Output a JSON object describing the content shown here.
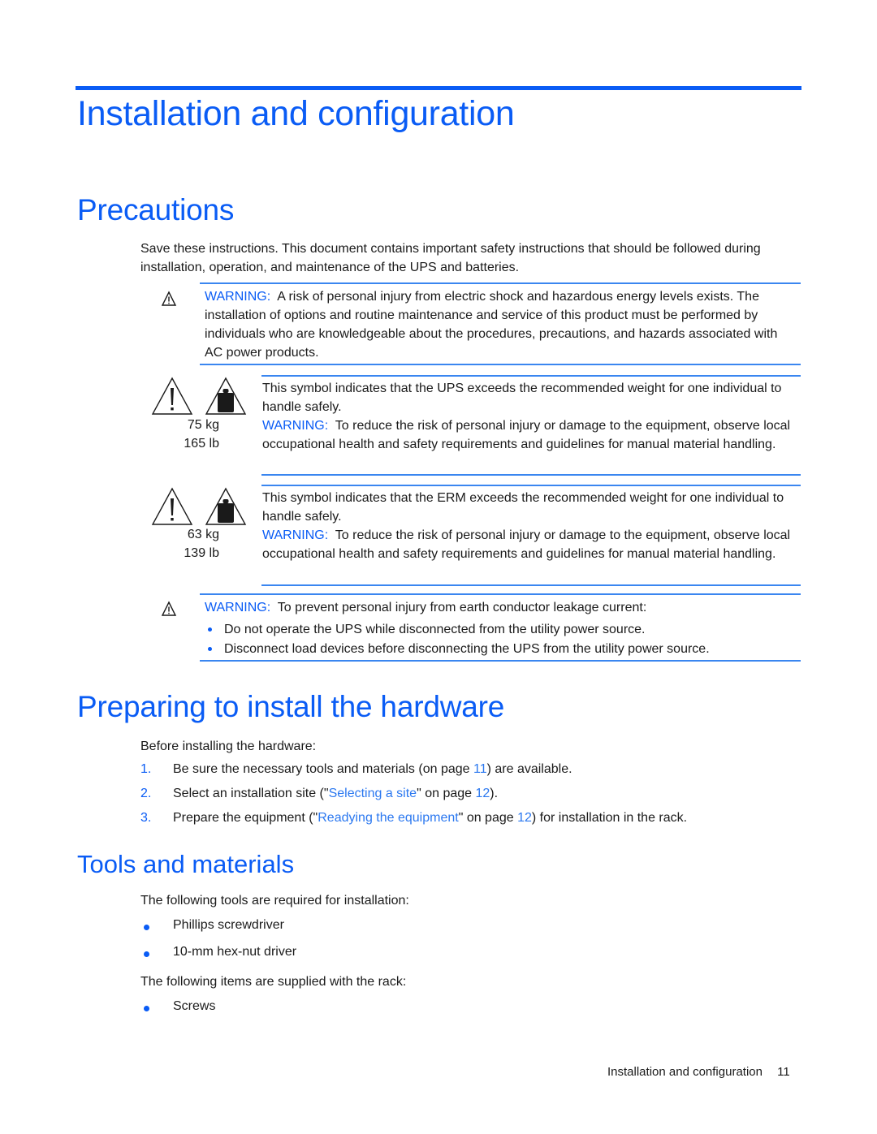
{
  "page": {
    "title": "Installation and configuration",
    "footer": {
      "section": "Installation and configuration",
      "page_number": "11"
    }
  },
  "precautions": {
    "heading": "Precautions",
    "intro": "Save these instructions. This document contains important safety instructions that should be followed during installation, operation, and maintenance of the UPS and batteries.",
    "warning1": {
      "icon": "warning-triangle-icon",
      "label": "WARNING:",
      "text": "A risk of personal injury from electric shock and hazardous energy levels exists. The installation of options and routine maintenance and service of this product must be performed by individuals who are knowledgeable about the procedures, precautions, and hazards associated with AC power products."
    },
    "weight_ups": {
      "icons": [
        "exclamation-triangle-icon",
        "weight-triangle-icon"
      ],
      "kg": "75 kg",
      "lb": "165 lb",
      "symbol_text": "This symbol indicates that the UPS exceeds the recommended weight for one individual to handle safely.",
      "label": "WARNING:",
      "text": "To reduce the risk of personal injury or damage to the equipment, observe local occupational health and safety requirements and guidelines for manual material handling."
    },
    "weight_erm": {
      "icons": [
        "exclamation-triangle-icon",
        "weight-triangle-icon"
      ],
      "kg": "63 kg",
      "lb": "139 lb",
      "symbol_text": "This symbol indicates that the ERM exceeds the recommended weight for one individual to handle safely.",
      "label": "WARNING:",
      "text": "To reduce the risk of personal injury or damage to the equipment, observe local occupational health and safety requirements and guidelines for manual material handling."
    },
    "warning2": {
      "icon": "warning-triangle-icon",
      "label": "WARNING:",
      "text": "To prevent personal injury from earth conductor leakage current:",
      "bullets": [
        "Do not operate the UPS while disconnected from the utility power source.",
        "Disconnect load devices before disconnecting the UPS from the utility power source."
      ]
    }
  },
  "preparing": {
    "heading": "Preparing to install the hardware",
    "intro": "Before installing the hardware:",
    "steps": [
      {
        "num": "1.",
        "before": "Be sure the necessary tools and materials (on page ",
        "link": "",
        "mid": "",
        "page": "11",
        "after": ") are available."
      },
      {
        "num": "2.",
        "before": "Select an installation site (\"",
        "link": "Selecting a site",
        "mid": "\" on page ",
        "page": "12",
        "after": ")."
      },
      {
        "num": "3.",
        "before": "Prepare the equipment (\"",
        "link": "Readying the equipment",
        "mid": "\" on page ",
        "page": "12",
        "after": ") for installation in the rack."
      }
    ]
  },
  "tools": {
    "heading": "Tools and materials",
    "required_intro": "The following tools are required for installation:",
    "required": [
      "Phillips screwdriver",
      "10-mm hex-nut driver"
    ],
    "supplied_intro": "The following items are supplied with the rack:",
    "supplied": [
      "Screws"
    ]
  },
  "colors": {
    "accent": "#0a5cf5",
    "rule": "#3a86f0",
    "link": "#2b78f0",
    "text": "#1a1a1a"
  }
}
